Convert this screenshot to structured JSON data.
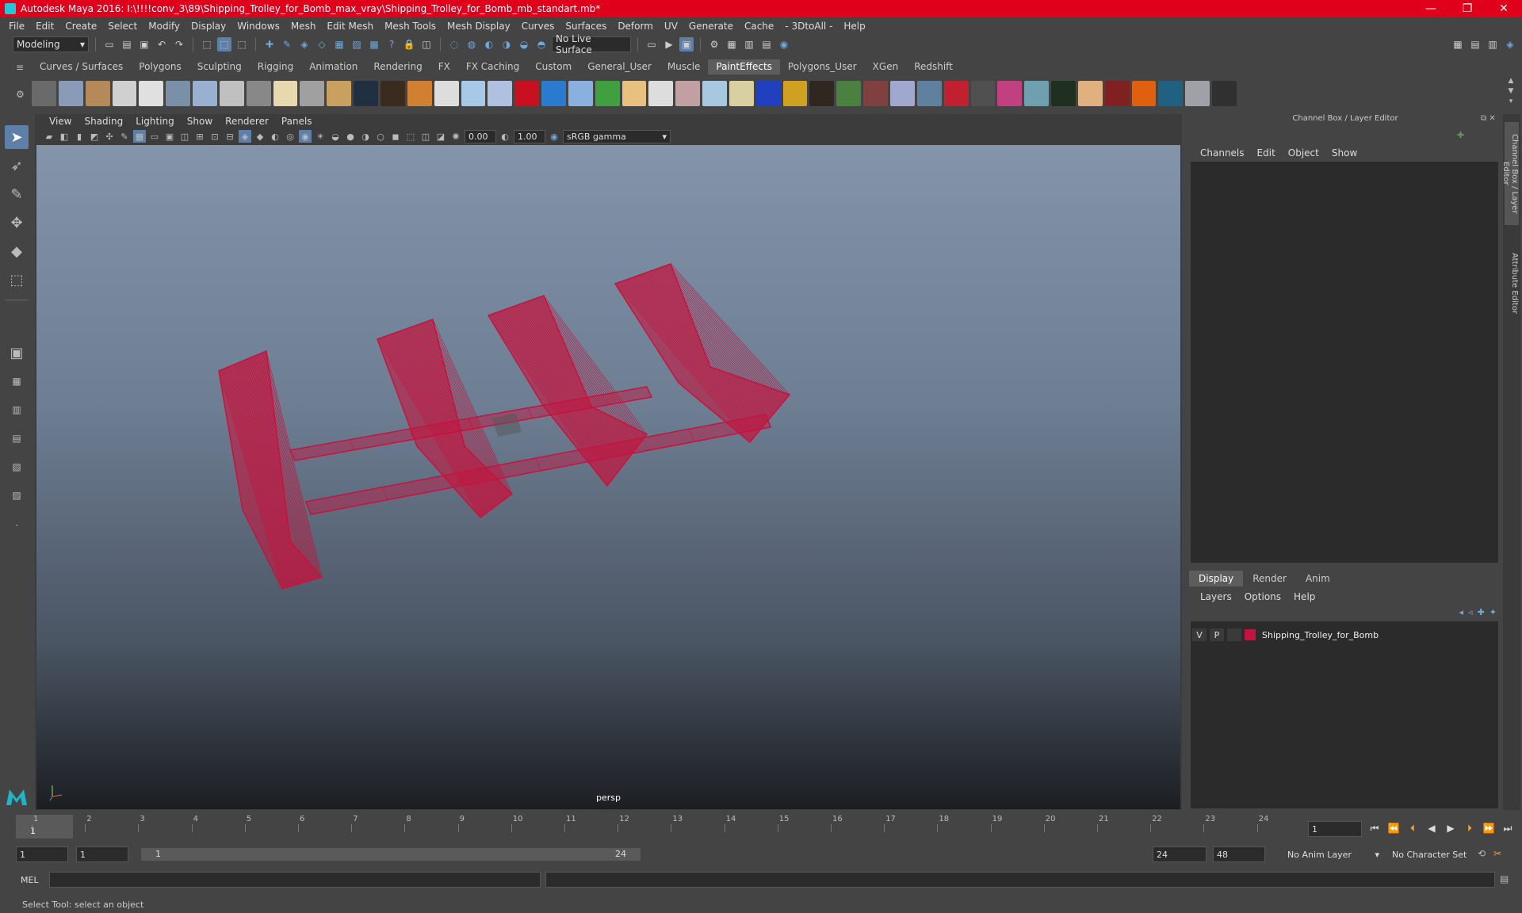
{
  "window": {
    "title": "Autodesk Maya 2016: I:\\!!!!conv_3\\89\\Shipping_Trolley_for_Bomb_max_vray\\Shipping_Trolley_for_Bomb_mb_standart.mb*",
    "minimize": "—",
    "restore": "❐",
    "close": "✕"
  },
  "menu": [
    "File",
    "Edit",
    "Create",
    "Select",
    "Modify",
    "Display",
    "Windows",
    "Mesh",
    "Edit Mesh",
    "Mesh Tools",
    "Mesh Display",
    "Curves",
    "Surfaces",
    "Deform",
    "UV",
    "Generate",
    "Cache",
    "- 3DtoAll -",
    "Help"
  ],
  "toolbar": {
    "mode": "Modeling",
    "live_surface": "No Live Surface"
  },
  "shelf_tabs": [
    "Curves / Surfaces",
    "Polygons",
    "Sculpting",
    "Rigging",
    "Animation",
    "Rendering",
    "FX",
    "FX Caching",
    "Custom",
    "General_User",
    "Muscle",
    "PaintEffects",
    "Polygons_User",
    "XGen",
    "Redshift"
  ],
  "shelf_active": "PaintEffects",
  "shelf_colors": [
    "#6a6a6a",
    "#8a9bb7",
    "#b58a5a",
    "#d0d0d0",
    "#e0e0e0",
    "#7a8fa8",
    "#9ab0d0",
    "#c0c0c0",
    "#888",
    "#e8d8b0",
    "#a0a0a0",
    "#c8a060",
    "#203040",
    "#3a2a20",
    "#d08030",
    "#ddd",
    "#a8c8e8",
    "#b0c0e0",
    "#c81020",
    "#2a7ad0",
    "#8ab0e0",
    "#40a040",
    "#e8c080",
    "#ddd",
    "#c0a0a0",
    "#a8c8e0",
    "#d8d0a0",
    "#2040c0",
    "#d0a020",
    "#302820",
    "#4a8040",
    "#804040",
    "#a0a8d0",
    "#6080a0",
    "#c02030",
    "#505050",
    "#c04080",
    "#70a0b0",
    "#203020",
    "#e0b080",
    "#802020",
    "#e06010",
    "#206080",
    "#a0a0a8",
    "#303030"
  ],
  "viewport": {
    "menu": [
      "View",
      "Shading",
      "Lighting",
      "Show",
      "Renderer",
      "Panels"
    ],
    "exposure": "0.00",
    "gamma": "1.00",
    "colorspace": "sRGB gamma",
    "camera": "persp",
    "wire_color": "#c4143e"
  },
  "channel_box": {
    "header": "Channel Box / Layer Editor",
    "menu": [
      "Channels",
      "Edit",
      "Object",
      "Show"
    ]
  },
  "layer_editor": {
    "tabs": [
      "Display",
      "Render",
      "Anim"
    ],
    "active_tab": "Display",
    "menu": [
      "Layers",
      "Options",
      "Help"
    ],
    "layer": {
      "v": "V",
      "p": "P",
      "name": "Shipping_Trolley_for_Bomb",
      "color": "#c4143e"
    }
  },
  "side_tabs": [
    "Channel Box / Layer Editor",
    "Attribute Editor"
  ],
  "timeline": {
    "ticks": [
      "1",
      "2",
      "3",
      "4",
      "5",
      "6",
      "7",
      "8",
      "9",
      "10",
      "11",
      "12",
      "13",
      "14",
      "15",
      "16",
      "17",
      "18",
      "19",
      "20",
      "21",
      "22",
      "23",
      "24"
    ],
    "current_frame": "1",
    "current_field": "1"
  },
  "range": {
    "start": "1",
    "start2": "1",
    "slider_start": "1",
    "slider_end": "24",
    "end": "24",
    "end2": "48",
    "anim_layer": "No Anim Layer",
    "character_set": "No Character Set"
  },
  "cmdline": {
    "label": "MEL"
  },
  "status": "Select Tool: select an object"
}
